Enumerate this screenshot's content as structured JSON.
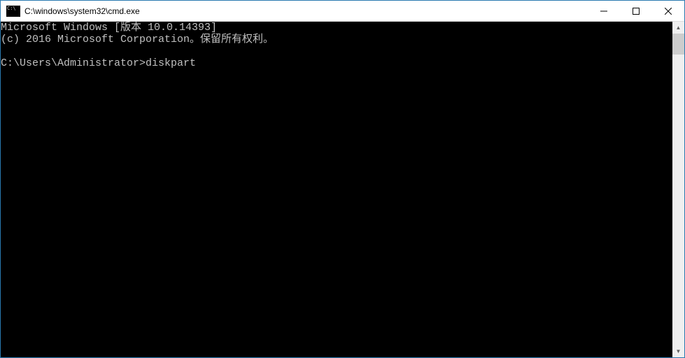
{
  "titlebar": {
    "title": "C:\\windows\\system32\\cmd.exe"
  },
  "terminal": {
    "line1": "Microsoft Windows [版本 10.0.14393]",
    "line2": "(c) 2016 Microsoft Corporation。保留所有权利。",
    "line3": "",
    "prompt": "C:\\Users\\Administrator>",
    "command": "diskpart"
  }
}
